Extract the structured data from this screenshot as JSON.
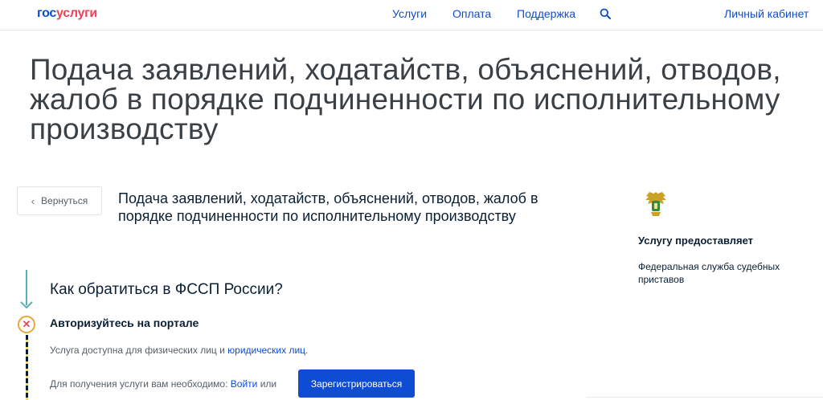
{
  "header": {
    "logo_part1": "гос",
    "logo_part2": "услуги",
    "nav": [
      "Услуги",
      "Оплата",
      "Поддержка"
    ],
    "cabinet": "Личный кабинет"
  },
  "page": {
    "title": "Подача заявлений, ходатайств, объяснений, отводов, жалоб в порядке подчиненности по исполнительному производству"
  },
  "service": {
    "back_label": "Вернуться",
    "title": "Подача заявлений, ходатайств, объяснений, отводов, жалоб в порядке подчиненности по исполнительному производству"
  },
  "provider": {
    "label": "Услугу предоставляет",
    "name": "Федеральная служба судебных приставов"
  },
  "steps": {
    "how_heading": "Как обратиться в ФССП России?",
    "auth_heading": "Авторизуйтесь на портале",
    "availability_text": "Услуга доступна для физических лиц и ",
    "availability_link": "юридических лиц",
    "availability_end": ".",
    "need_text": "Для получения услуги вам необходимо: ",
    "login_link": "Войти",
    "or_text": " или",
    "register_label": "Зарегистрироваться"
  },
  "colors": {
    "accent": "#0d4cd3",
    "logo_red": "#ee3f58",
    "track": "#57b0b8",
    "warn_ring": "#e7a83b"
  }
}
